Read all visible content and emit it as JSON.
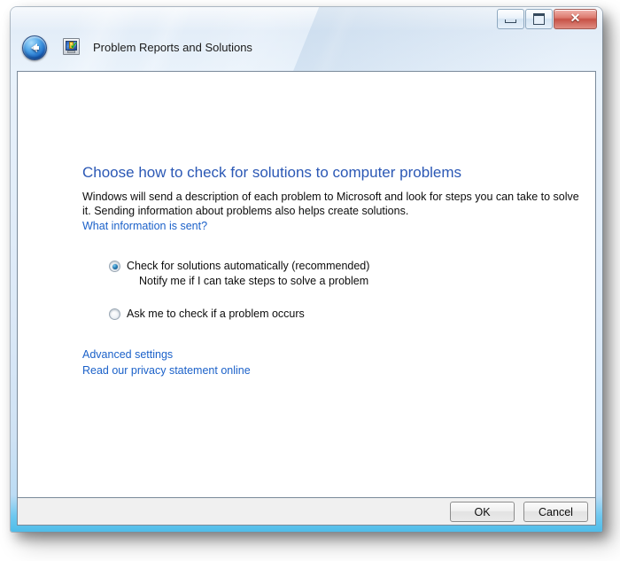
{
  "window": {
    "title": "Problem Reports and Solutions",
    "app_icon_name": "problem-reports-icon",
    "back_button_label": "Back",
    "caption": {
      "minimize_label": "Minimize",
      "maximize_label": "Maximize",
      "close_label": "Close",
      "close_glyph": "✕"
    }
  },
  "content": {
    "heading": "Choose how to check for solutions to computer problems",
    "body_line_1": "Windows will send a description of each problem to Microsoft and look for steps you can take to solve it.",
    "body_line_2": "Sending information about problems also helps create solutions.",
    "what_information_link": "What information is sent?",
    "options": [
      {
        "label": "Check for solutions automatically (recommended)",
        "sub_label": "Notify me if I can take steps to solve a problem",
        "checked": true
      },
      {
        "label": "Ask me to check if a problem occurs",
        "sub_label": "",
        "checked": false
      }
    ],
    "advanced_settings_link": "Advanced settings",
    "privacy_link": "Read our privacy statement online"
  },
  "command_bar": {
    "ok_label": "OK",
    "cancel_label": "Cancel"
  },
  "colors": {
    "heading_blue": "#2b58b5",
    "link_blue": "#1b61c9",
    "glass_blue": "#dce9f7",
    "frame_accent": "#4fbde9",
    "close_red": "#c75247",
    "content_background": "#ffffff",
    "command_bar_background": "#f0f0f0"
  }
}
